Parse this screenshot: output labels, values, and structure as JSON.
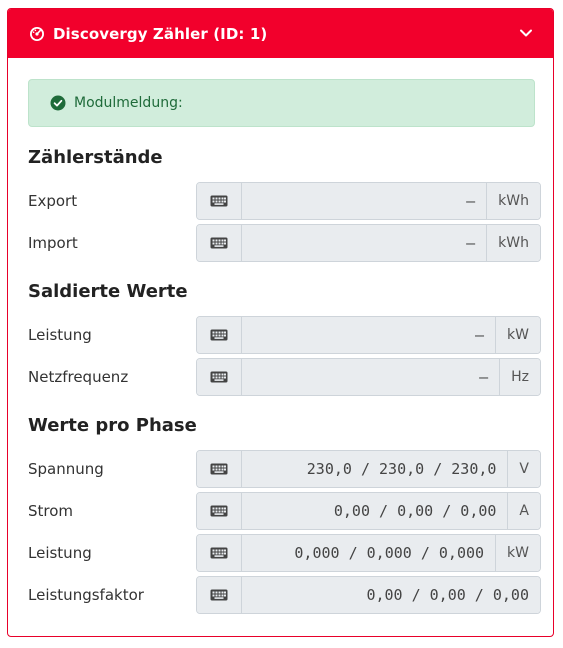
{
  "header": {
    "title": "Discovergy Zähler (ID: 1)",
    "icon": "gauge-icon",
    "toggle_icon": "chevron-down-icon",
    "accent_color": "#f2002c"
  },
  "alert": {
    "text": "Modulmeldung:",
    "icon": "check-circle-icon",
    "color": "#d1eddc"
  },
  "sections": {
    "zaehlerstaende": "Zählerstände",
    "saldierte": "Saldierte Werte",
    "phase": "Werte pro Phase"
  },
  "rows": {
    "export": {
      "label": "Export",
      "value": "–",
      "unit": "kWh"
    },
    "import": {
      "label": "Import",
      "value": "–",
      "unit": "kWh"
    },
    "leistung_saldiert": {
      "label": "Leistung",
      "value": "–",
      "unit": "kW"
    },
    "netzfrequenz": {
      "label": "Netzfrequenz",
      "value": "–",
      "unit": "Hz"
    },
    "spannung": {
      "label": "Spannung",
      "value": "230,0 / 230,0 / 230,0",
      "unit": "V"
    },
    "strom": {
      "label": "Strom",
      "value": "0,00 / 0,00 / 0,00",
      "unit": "A"
    },
    "leistung_phase": {
      "label": "Leistung",
      "value": "0,000 / 0,000 / 0,000",
      "unit": "kW"
    },
    "leistungsfaktor": {
      "label": "Leistungsfaktor",
      "value": "0,00 / 0,00 / 0,00",
      "unit": ""
    }
  }
}
